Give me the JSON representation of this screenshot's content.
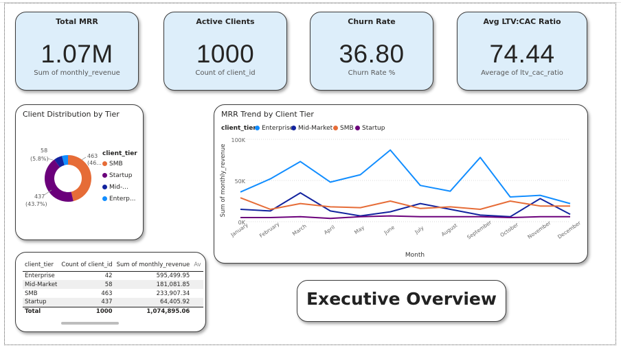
{
  "kpis": [
    {
      "title": "Total MRR",
      "value": "1.07M",
      "subtitle": "Sum of monthly_revenue"
    },
    {
      "title": "Active Clients",
      "value": "1000",
      "subtitle": "Count of client_id"
    },
    {
      "title": "Churn Rate",
      "value": "36.80",
      "subtitle": "Churn Rate %"
    },
    {
      "title": "Avg LTV:CAC Ratio",
      "value": "74.44",
      "subtitle": "Average of ltv_cac_ratio"
    }
  ],
  "donut": {
    "title": "Client Distribution by Tier",
    "legend_title": "client_tier",
    "legend": [
      {
        "label": "SMB",
        "color": "#E66C37"
      },
      {
        "label": "Startup",
        "color": "#6B007B"
      },
      {
        "label": "Mid-...",
        "color": "#12239E"
      },
      {
        "label": "Enterp...",
        "color": "#118DFF"
      }
    ],
    "labels": {
      "smb_top": "463",
      "smb_bottom": "(46...",
      "startup_top": "437",
      "startup_bottom": "(43.7%)",
      "mid_top": "58",
      "mid_bottom": "(5.8%)"
    }
  },
  "line_chart": {
    "title": "MRR Trend by Client Tier",
    "legend_title": "client_tier",
    "ylabel": "Sum of monthly_revenue",
    "xlabel": "Month",
    "y_ticks": [
      "100K",
      "50K",
      "0K"
    ]
  },
  "chart_data": [
    {
      "type": "pie",
      "title": "Client Distribution by Tier",
      "categories": [
        "SMB",
        "Startup",
        "Mid-Market",
        "Enterprise"
      ],
      "values": [
        463,
        437,
        58,
        42
      ],
      "colors": [
        "#E66C37",
        "#6B007B",
        "#12239E",
        "#118DFF"
      ],
      "legend": "right"
    },
    {
      "type": "line",
      "title": "MRR Trend by Client Tier",
      "xlabel": "Month",
      "ylabel": "Sum of monthly_revenue",
      "ylim": [
        0,
        100000
      ],
      "grid": true,
      "legend": "top-left",
      "categories": [
        "January",
        "February",
        "March",
        "April",
        "May",
        "June",
        "July",
        "August",
        "September",
        "October",
        "November",
        "December"
      ],
      "series": [
        {
          "name": "Enterprise",
          "color": "#118DFF",
          "values": [
            36000,
            52000,
            73000,
            48000,
            57000,
            87000,
            44000,
            37000,
            78000,
            30000,
            32000,
            22000
          ]
        },
        {
          "name": "Mid-Market",
          "color": "#12239E",
          "values": [
            15000,
            13000,
            35000,
            13000,
            7000,
            12000,
            22000,
            15000,
            8000,
            6000,
            28000,
            9000
          ]
        },
        {
          "name": "SMB",
          "color": "#E66C37",
          "values": [
            29000,
            15000,
            22000,
            18000,
            17000,
            25000,
            16000,
            18000,
            15000,
            25000,
            19000,
            19000
          ]
        },
        {
          "name": "Startup",
          "color": "#6B007B",
          "values": [
            5000,
            5000,
            6000,
            4000,
            6000,
            7000,
            6000,
            6000,
            6000,
            5000,
            6000,
            6000
          ]
        }
      ]
    }
  ],
  "table": {
    "headers": [
      "client_tier",
      "Count of client_id",
      "Sum of monthly_revenue",
      "Av"
    ],
    "rows": [
      [
        "Enterprise",
        "42",
        "595,499.95"
      ],
      [
        "Mid-Market",
        "58",
        "181,081.85"
      ],
      [
        "SMB",
        "463",
        "233,907.34"
      ],
      [
        "Startup",
        "437",
        "64,405.92"
      ]
    ],
    "total": [
      "Total",
      "1000",
      "1,074,895.06"
    ]
  },
  "banner": {
    "text": "Executive Overview"
  }
}
